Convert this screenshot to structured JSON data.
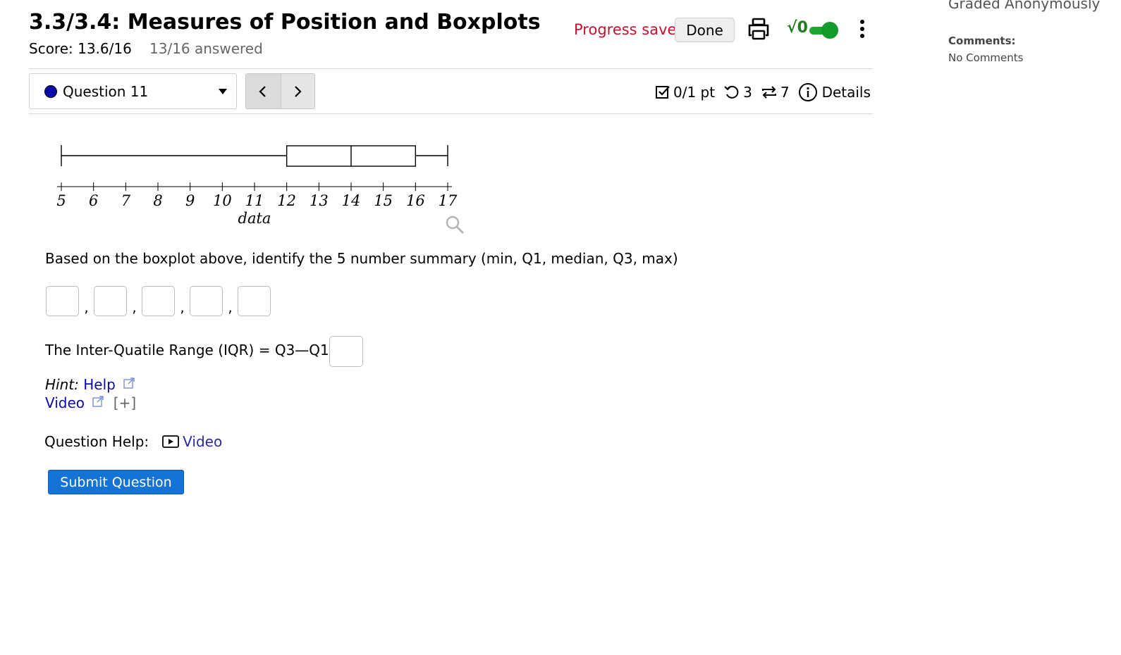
{
  "header": {
    "title": "3.3/3.4: Measures of Position and Boxplots",
    "score": "Score: 13.6/16",
    "answered": "13/16 answered",
    "progress_status": "Progress saved",
    "done_label": "Done",
    "sqrt_label": "√0",
    "sqrt_toggle_on": true
  },
  "sidebar": {
    "graded": "Graded Anonymously",
    "comments_heading": "Comments:",
    "comments_text": "No Comments"
  },
  "question_nav": {
    "selected": "Question 11",
    "status_color": "#0a0aa8"
  },
  "question_meta": {
    "points": "0/1 pt",
    "retries": "3",
    "attempts": "7",
    "details_label": "Details"
  },
  "chart_data": {
    "type": "boxplot",
    "xlabel": "data",
    "xlim": [
      5,
      17
    ],
    "ticks": [
      5,
      6,
      7,
      8,
      9,
      10,
      11,
      12,
      13,
      14,
      15,
      16,
      17
    ],
    "min": 5,
    "q1": 12,
    "median": 14,
    "q3": 16,
    "max": 17
  },
  "question": {
    "prompt": "Based on the boxplot above, identify the 5 number summary (min, Q1, median, Q3, max)",
    "answers": [
      "",
      "",
      "",
      "",
      ""
    ],
    "separator": ",",
    "iqr_label": "The Inter-Quatile Range (IQR) = Q3—Q1 =",
    "iqr_value": "",
    "hint_label": "Hint:",
    "hint_link": "Help",
    "video_link": "Video",
    "expand": "[+]",
    "help_label": "Question Help:",
    "help_video": "Video",
    "submit_label": "Submit Question"
  }
}
